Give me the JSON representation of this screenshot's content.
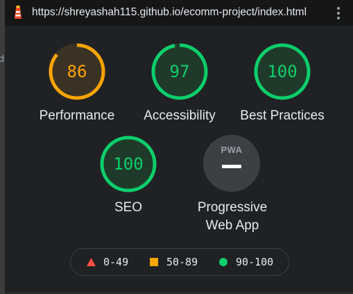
{
  "browser": {
    "url": "https://shreyashah115.github.io/ecomm-project/index.html",
    "side_fragment": "d"
  },
  "colors": {
    "fail": "#ff4e42",
    "average": "#ffa400",
    "pass": "#0cce6b",
    "track_fail": "#3e2e2c",
    "track_average": "#3a3224",
    "track_pass": "#1f3a2a"
  },
  "categories": [
    {
      "label": "Performance",
      "score": "86",
      "fraction": 0.86,
      "rating": "average"
    },
    {
      "label": "Accessibility",
      "score": "97",
      "fraction": 0.97,
      "rating": "pass"
    },
    {
      "label": "Best Practices",
      "score": "100",
      "fraction": 1.0,
      "rating": "pass"
    },
    {
      "label": "SEO",
      "score": "100",
      "fraction": 1.0,
      "rating": "pass"
    }
  ],
  "pwa": {
    "badge": "PWA",
    "label_line1": "Progressive",
    "label_line2": "Web App"
  },
  "legend": [
    {
      "range": "0-49",
      "shape": "triangle",
      "rating": "fail"
    },
    {
      "range": "50-89",
      "shape": "square",
      "rating": "average"
    },
    {
      "range": "90-100",
      "shape": "circle",
      "rating": "pass"
    }
  ]
}
